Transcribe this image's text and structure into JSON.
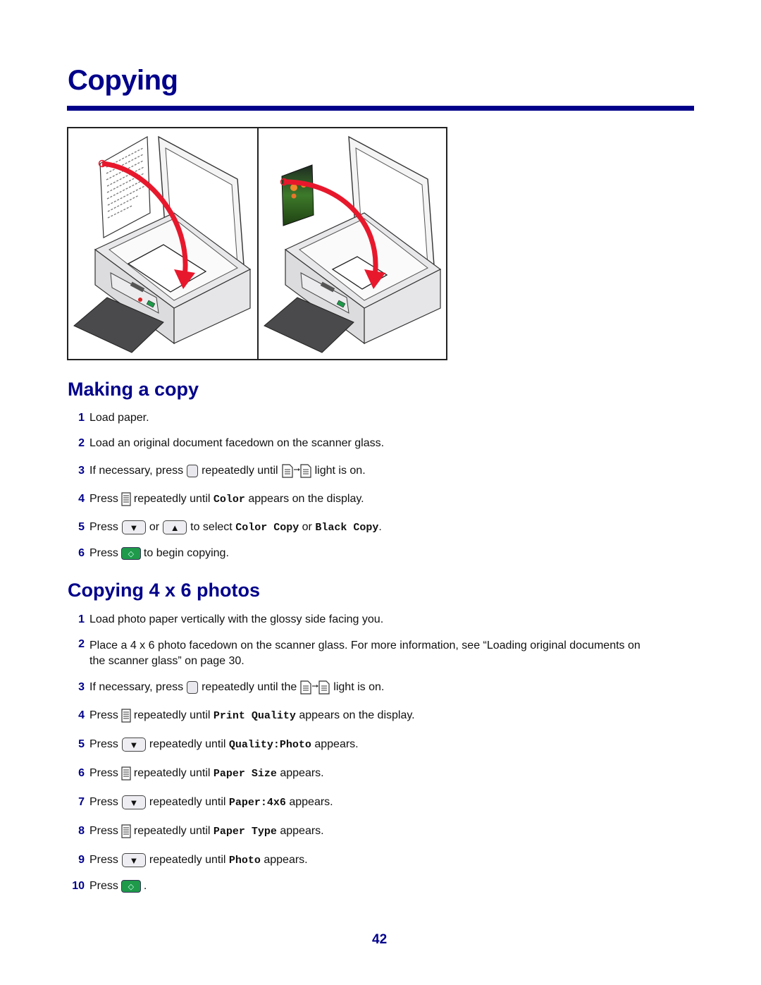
{
  "page": {
    "title": "Copying",
    "page_number": "42",
    "accent_color": "#00008b"
  },
  "figure": {
    "left_panel": {
      "subject": "text document",
      "arrow_color": "#e8182c"
    },
    "right_panel": {
      "subject": "4 x 6 photo",
      "arrow_color": "#e8182c"
    }
  },
  "making_a_copy": {
    "heading": "Making a copy",
    "steps": [
      {
        "n": "1",
        "parts": [
          "Load paper."
        ]
      },
      {
        "n": "2",
        "parts": [
          "Load an original document facedown on the scanner glass."
        ]
      },
      {
        "n": "3",
        "pre": "If necessary, press",
        "icon1": "copy-mode-button-icon",
        "mid": "repeatedly until",
        "icon2": "copy-light-icon",
        "post": "light is on."
      },
      {
        "n": "4",
        "pre": "Press",
        "icon1": "menu-button-icon",
        "mid": "repeatedly until",
        "code": "Color",
        "post": "appears on the display."
      },
      {
        "n": "5",
        "pre": "Press",
        "icon1": "down-arrow-button-icon",
        "or": "or",
        "icon2": "up-arrow-button-icon",
        "mid": "to select",
        "code1": "Color Copy",
        "or2": "or",
        "code2": "Black Copy",
        "post": "."
      },
      {
        "n": "6",
        "pre": "Press",
        "icon1": "start-button-icon",
        "post": "to begin copying."
      }
    ]
  },
  "copying_photos": {
    "heading": "Copying 4 x 6 photos",
    "steps": [
      {
        "n": "1",
        "text": "Load photo paper vertically with the glossy side facing you."
      },
      {
        "n": "2",
        "line1": "Place a 4 x 6 photo facedown on the scanner glass. For more information, see “Loading original documents on",
        "line2": "the scanner glass” on page 30."
      },
      {
        "n": "3",
        "pre": "If necessary, press",
        "mid": "repeatedly until the",
        "post": "light is on."
      },
      {
        "n": "4",
        "pre": "Press",
        "mid": "repeatedly until",
        "code": "Print Quality",
        "post": "appears on the display."
      },
      {
        "n": "5",
        "pre": "Press",
        "mid": "repeatedly until",
        "code": "Quality:Photo",
        "post": "appears."
      },
      {
        "n": "6",
        "pre": "Press",
        "mid": "repeatedly until",
        "code": "Paper Size",
        "post": "appears."
      },
      {
        "n": "7",
        "pre": "Press",
        "mid": "repeatedly until",
        "code": "Paper:4x6",
        "post": "appears."
      },
      {
        "n": "8",
        "pre": "Press",
        "mid": "repeatedly until",
        "code": "Paper Type",
        "post": "appears."
      },
      {
        "n": "9",
        "pre": "Press",
        "mid": "repeatedly until",
        "code": "Photo",
        "post": "appears."
      },
      {
        "n": "10",
        "pre": "Press",
        "post": "."
      }
    ]
  }
}
